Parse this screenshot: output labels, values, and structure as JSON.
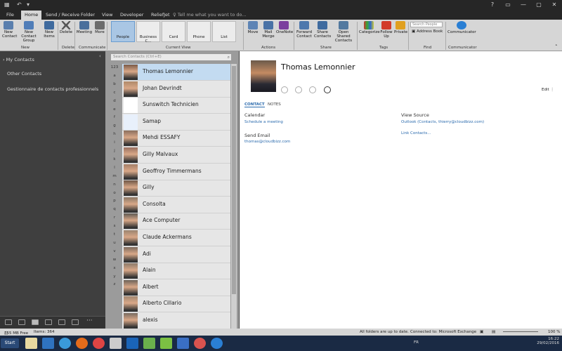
{
  "titlebar": {
    "title": "",
    "controls": [
      "?",
      "▭",
      "—",
      "▢",
      "✕"
    ]
  },
  "tabs": [
    "File",
    "Home",
    "Send / Receive",
    "Folder",
    "View",
    "Developer",
    "ReliefJet"
  ],
  "tell_me": "Tell me what you want to do...",
  "ribbon": {
    "new_contact": "New Contact",
    "new_contact_group": "New Contact Group",
    "new_items": "New Items",
    "delete": "Delete",
    "meeting": "Meeting",
    "more": "More",
    "views": [
      "People",
      "Business C...",
      "Card",
      "Phone",
      "List"
    ],
    "move": "Move",
    "mail_merge": "Mail Merge",
    "onenote": "OneNote",
    "forward_contact": "Forward Contact",
    "share_contacts": "Share Contacts",
    "open_shared": "Open Shared Contacts",
    "categorize": "Categorize",
    "follow_up": "Follow Up",
    "private": "Private",
    "search_people": "Search People",
    "address_book": "Address Book",
    "communicator": "Communicator",
    "groups": [
      "New",
      "Delete",
      "Communicate",
      "Current View",
      "Actions",
      "Share",
      "Tags",
      "Find",
      "Communicator"
    ]
  },
  "nav": {
    "my_contacts": "My Contacts",
    "items": [
      "Other Contacts",
      "Gestionnaire de contacts professionnels"
    ]
  },
  "search_placeholder": "Search Contacts (Ctrl+E)",
  "alphabet": [
    "123",
    "a",
    "b",
    "c",
    "d",
    "e",
    "f",
    "g",
    "h",
    "i",
    "j",
    "k",
    "l",
    "m",
    "n",
    "o",
    "p",
    "q",
    "r",
    "s",
    "t",
    "u",
    "v",
    "w",
    "x",
    "y",
    "z"
  ],
  "contacts": [
    {
      "name": "Thomas Lemonnier",
      "selected": true
    },
    {
      "name": "Johan Devrindt"
    },
    {
      "name": "Sunswitch Technicien"
    },
    {
      "name": "Samap"
    },
    {
      "name": "Mehdi ESSAFY"
    },
    {
      "name": "Gilly  Malvaux"
    },
    {
      "name": "Geoffroy  Timmermans"
    },
    {
      "name": "Gilly"
    },
    {
      "name": "Consolta"
    },
    {
      "name": "Ace Computer"
    },
    {
      "name": "Claude Ackermans"
    },
    {
      "name": "Adi"
    },
    {
      "name": "Alain"
    },
    {
      "name": "Albert"
    },
    {
      "name": "Alberto Cillario"
    },
    {
      "name": "alexis"
    }
  ],
  "detail": {
    "name": "Thomas Lemonnier",
    "edit": "Edit",
    "tab_contact": "CONTACT",
    "tab_notes": "NOTES",
    "calendar_label": "Calendar",
    "schedule_link": "Schedule a meeting",
    "send_email_label": "Send Email",
    "email": "thomas@cloudbizz.com",
    "view_source_label": "View Source",
    "view_source_link": "Outlook (Contacts, thierry@cloudbizz.com)",
    "link_contacts": "Link Contacts..."
  },
  "status": {
    "free": "355 MB Free",
    "items": "Items: 364",
    "folders": "All folders are up to date.",
    "connection": "Connected to: Microsoft Exchange",
    "zoom": "100 %"
  },
  "taskbar": {
    "start": "Start",
    "lang": "FR",
    "time": "16:22",
    "date": "29/02/2016"
  }
}
